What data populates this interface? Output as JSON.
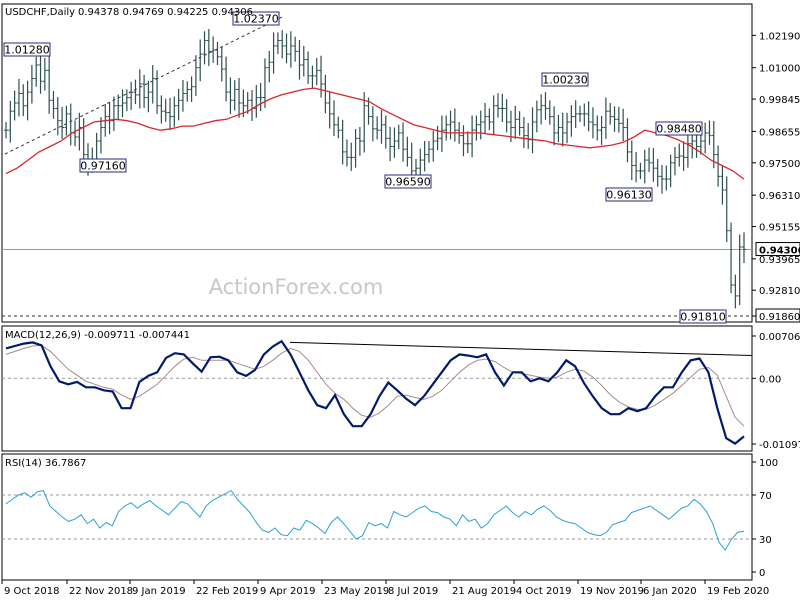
{
  "chart_data": [
    {
      "panel": "price",
      "type": "ohlc",
      "title": "USDCHF,Daily",
      "ohlc_header": "0.94378 0.94769 0.94225 0.94306",
      "last_price_label": "0.94306",
      "ylim": [
        0.9186,
        1.0305
      ],
      "y_ticks": [
        "1.02190",
        "1.01000",
        "0.99845",
        "0.98655",
        "0.97500",
        "0.96310",
        "0.95155",
        "0.93965",
        "0.92810",
        "0.91860"
      ],
      "grid": false,
      "annotations": [
        {
          "label": "1.01280",
          "value": 1.0128
        },
        {
          "label": "0.97160",
          "value": 0.9716
        },
        {
          "label": "1.02370",
          "value": 1.0237
        },
        {
          "label": "0.96590",
          "value": 0.9659
        },
        {
          "label": "1.00230",
          "value": 1.0023
        },
        {
          "label": "0.98480",
          "value": 0.9848
        },
        {
          "label": "0.96130",
          "value": 0.9613
        },
        {
          "label": "0.91810",
          "value": 0.9181
        }
      ],
      "horizontal_lines": [
        {
          "value": 0.94306,
          "color": "#999999",
          "style": "solid"
        },
        {
          "value": 0.9186,
          "color": "#333333",
          "style": "dashed"
        }
      ],
      "series": [
        {
          "name": "",
          "type": "ohlc-bars",
          "color": "#2f4f4f",
          "close": [
            0.987,
            0.994,
            0.997,
            1.0005,
            0.996,
            1.001,
            1.006,
            1.011,
            1.005,
            1.009,
            0.998,
            0.995,
            0.9905,
            0.988,
            0.993,
            0.986,
            0.9845,
            0.988,
            0.978,
            0.9756,
            0.9755,
            0.983,
            0.988,
            0.992,
            0.9905,
            0.996,
            0.996,
            0.997,
            0.999,
            1.001,
            1.0,
            1.004,
            0.999,
            1.001,
            1.006,
            0.996,
            0.994,
            0.9935,
            0.992,
            0.996,
            0.998,
            1.0005,
            1.002,
            1.003,
            1.01,
            1.015,
            1.02,
            1.016,
            1.0165,
            1.014,
            1.0095,
            1.001,
            0.998,
            1.002,
            0.997,
            0.996,
            0.998,
            0.995,
            0.999,
            0.999,
            1.01,
            1.012,
            1.018,
            1.02,
            1.018,
            1.015,
            1.018,
            1.016,
            1.011,
            1.013,
            1.007,
            1.007,
            1.009,
            1.004,
            0.997,
            0.993,
            0.989,
            0.987,
            0.979,
            0.977,
            0.977,
            0.984,
            0.983,
            0.996,
            0.992,
            0.9875,
            0.987,
            0.989,
            0.984,
            0.981,
            0.983,
            0.986,
            0.98,
            0.977,
            0.972,
            0.973,
            0.976,
            0.978,
            0.98,
            0.983,
            0.984,
            0.987,
            0.989,
            0.99,
            0.987,
            0.985,
            0.982,
            0.982,
            0.987,
            0.989,
            0.99,
            0.992,
            0.99,
            0.996,
            0.995,
            0.995,
            0.99,
            0.988,
            0.991,
            0.988,
            0.985,
            0.9835,
            0.99,
            0.9945,
            0.996,
            0.995,
            0.992,
            0.986,
            0.988,
            0.986,
            0.99,
            0.992,
            0.993,
            0.993,
            0.993,
            0.99,
            0.989,
            0.987,
            0.988,
            0.994,
            0.992,
            0.991,
            0.9895,
            0.988,
            0.979,
            0.974,
            0.972,
            0.972,
            0.976,
            0.975,
            0.973,
            0.97,
            0.969,
            0.969,
            0.975,
            0.977,
            0.9775,
            0.977,
            0.982,
            0.983,
            0.981,
            0.983,
            0.986,
            0.985,
            0.978,
            0.97,
            0.965,
            0.95,
            0.93,
            0.926,
            0.944,
            0.9431
          ]
        },
        {
          "name": "",
          "type": "line",
          "color": "#d9262c",
          "values": [
            0.971,
            0.973,
            0.976,
            0.979,
            0.981,
            0.983,
            0.986,
            0.988,
            0.99,
            0.9905,
            0.991,
            0.9905,
            0.9895,
            0.988,
            0.987,
            0.9875,
            0.9885,
            0.9885,
            0.9895,
            0.9905,
            0.991,
            0.9925,
            0.994,
            0.9965,
            0.9985,
            1.0,
            1.001,
            1.002,
            1.0025,
            1.0015,
            1.0005,
            0.9995,
            0.9985,
            0.9975,
            0.995,
            0.993,
            0.991,
            0.989,
            0.988,
            0.987,
            0.986,
            0.986,
            0.986,
            0.986,
            0.9855,
            0.985,
            0.9845,
            0.984,
            0.9835,
            0.983,
            0.982,
            0.9815,
            0.981,
            0.9805,
            0.981,
            0.9815,
            0.9825,
            0.9845,
            0.987,
            0.986,
            0.985,
            0.9835,
            0.9815,
            0.979,
            0.976,
            0.974,
            0.972,
            0.969
          ]
        }
      ],
      "ma_anchor_index": [
        0,
        4,
        8,
        12,
        16,
        20,
        24,
        28,
        32,
        36,
        40,
        44,
        48,
        52,
        56,
        60,
        64,
        68,
        72,
        76,
        80,
        84,
        88,
        92,
        96,
        100,
        104,
        108,
        112,
        116,
        120,
        124,
        128,
        132,
        136,
        140,
        144,
        148,
        152,
        156,
        160,
        164,
        168,
        172,
        176,
        180,
        184,
        188,
        192,
        196,
        200,
        204,
        208,
        212,
        216,
        220,
        224,
        228,
        232,
        236,
        240,
        244,
        248,
        252,
        256,
        260,
        264,
        268
      ]
    },
    {
      "panel": "macd",
      "type": "line",
      "title": "MACD(12,26,9) -0.009711 -0.007441",
      "ylim": [
        -0.010975,
        0.007066
      ],
      "y_ticks": [
        "0.007066",
        "0.00",
        "-0.010975"
      ],
      "grid": false,
      "series": [
        {
          "name": "",
          "color": "#001a6e",
          "values": [
            0.005,
            0.0054,
            0.0058,
            0.006,
            0.0055,
            0.002,
            -0.0005,
            -0.001,
            -0.0006,
            -0.0015,
            -0.0015,
            -0.002,
            -0.0022,
            -0.005,
            -0.005,
            -0.0006,
            0.0004,
            0.001,
            0.0034,
            0.0042,
            0.004,
            0.0025,
            0.0011,
            0.0035,
            0.0036,
            0.003,
            0.001,
            0.0004,
            0.0014,
            0.004,
            0.0053,
            0.0062,
            0.004,
            0.001,
            -0.002,
            -0.0045,
            -0.005,
            -0.0028,
            -0.006,
            -0.008,
            -0.008,
            -0.006,
            -0.003,
            -0.0007,
            -0.002,
            -0.0034,
            -0.0045,
            -0.003,
            -0.001,
            0.001,
            0.003,
            0.004,
            0.0038,
            0.0035,
            0.004,
            0.001,
            -0.0012,
            0.001,
            0.001,
            -0.0005,
            0.0,
            -0.0005,
            0.001,
            0.003,
            0.002,
            -0.0008,
            -0.003,
            -0.005,
            -0.006,
            -0.006,
            -0.005,
            -0.0055,
            -0.005,
            -0.003,
            -0.0015,
            -0.0015,
            0.001,
            0.003,
            0.0033,
            0.001,
            -0.005,
            -0.01,
            -0.0109,
            -0.0097
          ]
        },
        {
          "name": "",
          "color": "#a88a8a",
          "values": [
            0.004,
            0.0045,
            0.005,
            0.0054,
            0.0055,
            0.0045,
            0.003,
            0.0015,
            0.0005,
            -0.0005,
            -0.001,
            -0.0015,
            -0.0018,
            -0.0028,
            -0.0035,
            -0.003,
            -0.002,
            -0.001,
            0.0005,
            0.002,
            0.0032,
            0.0035,
            0.003,
            0.003,
            0.003,
            0.003,
            0.0025,
            0.002,
            0.0015,
            0.002,
            0.003,
            0.0042,
            0.005,
            0.0045,
            0.003,
            0.001,
            -0.001,
            -0.0025,
            -0.0035,
            -0.005,
            -0.0062,
            -0.0065,
            -0.0058,
            -0.0045,
            -0.003,
            -0.0028,
            -0.0032,
            -0.0035,
            -0.003,
            -0.002,
            -0.0005,
            0.001,
            0.0022,
            0.003,
            0.0032,
            0.0028,
            0.0018,
            0.001,
            0.0008,
            0.0005,
            0.0002,
            0.0,
            0.0002,
            0.001,
            0.0015,
            0.0012,
            0.0002,
            -0.0012,
            -0.0028,
            -0.004,
            -0.0048,
            -0.0052,
            -0.0052,
            -0.0045,
            -0.0035,
            -0.0025,
            -0.0012,
            0.0002,
            0.0015,
            0.0018,
            0.0005,
            -0.003,
            -0.0065,
            -0.008
          ]
        }
      ],
      "trendline": {
        "from": 0.006,
        "to": 0.0038
      }
    },
    {
      "panel": "rsi",
      "type": "line",
      "title": "RSI(14) 36.7867",
      "ylim": [
        0,
        100
      ],
      "y_ticks": [
        "100",
        "70",
        "30",
        "0"
      ],
      "levels": [
        70,
        30
      ],
      "grid": false,
      "x_tick_labels": [
        "9 Oct 2018",
        "22 Nov 2018",
        "9 Jan 2019",
        "22 Feb 2019",
        "9 Apr 2019",
        "23 May 2019",
        "8 Jul 2019",
        "21 Aug 2019",
        "4 Oct 2019",
        "19 Nov 2019",
        "6 Jan 2020",
        "19 Feb 2020"
      ],
      "series": [
        {
          "name": "",
          "color": "#2aa3d6",
          "values": [
            62,
            66,
            70,
            72,
            68,
            73,
            74,
            60,
            55,
            50,
            46,
            48,
            52,
            44,
            48,
            40,
            45,
            42,
            55,
            60,
            63,
            58,
            62,
            65,
            60,
            56,
            52,
            58,
            64,
            62,
            56,
            50,
            60,
            65,
            68,
            71,
            74,
            66,
            60,
            54,
            45,
            38,
            36,
            40,
            34,
            33,
            40,
            38,
            47,
            44,
            40,
            35,
            45,
            50,
            44,
            37,
            30,
            33,
            45,
            42,
            44,
            40,
            55,
            52,
            50,
            54,
            58,
            60,
            55,
            54,
            50,
            48,
            42,
            52,
            46,
            48,
            40,
            44,
            52,
            56,
            60,
            54,
            50,
            55,
            52,
            57,
            60,
            56,
            50,
            47,
            45,
            44,
            40,
            36,
            34,
            33,
            36,
            43,
            45,
            47,
            54,
            56,
            58,
            60,
            56,
            52,
            48,
            53,
            58,
            60,
            66,
            62,
            55,
            44,
            27,
            20,
            30,
            36,
            37
          ]
        }
      ]
    }
  ],
  "watermark": "ActionForex.com"
}
